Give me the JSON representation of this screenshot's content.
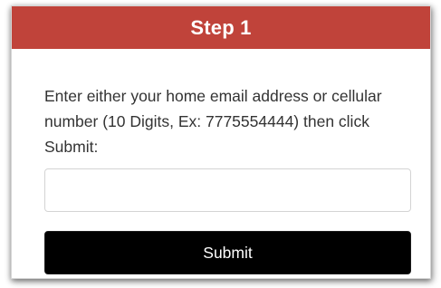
{
  "header": {
    "title": "Step 1",
    "color": "#c0433a"
  },
  "form": {
    "instructions": "Enter either your home email address or cellular number (10 Digits, Ex: 7775554444) then click Submit:",
    "input_value": "",
    "input_placeholder": "",
    "submit_label": "Submit"
  }
}
